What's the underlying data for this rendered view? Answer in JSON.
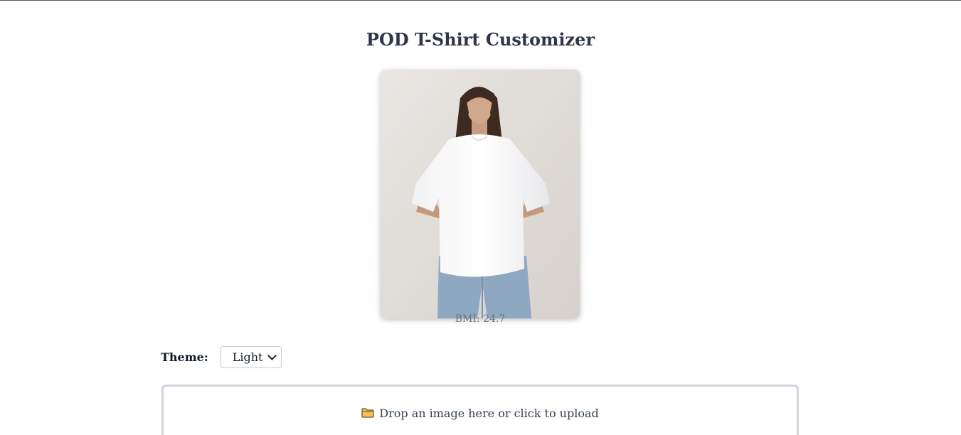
{
  "header": {
    "title": "POD T-Shirt Customizer"
  },
  "preview": {
    "image_alt": "Model wearing white oversized t-shirt and jeans",
    "bmi_text": "BMI: 24.7"
  },
  "theme": {
    "label": "Theme:",
    "selected": "Light"
  },
  "upload": {
    "icon": "folder-icon",
    "text": "Drop an image here or click to upload"
  },
  "colors": {
    "title": "#2d3748",
    "dropzone_border": "#d1d5db",
    "muted_text": "#6b7280"
  }
}
